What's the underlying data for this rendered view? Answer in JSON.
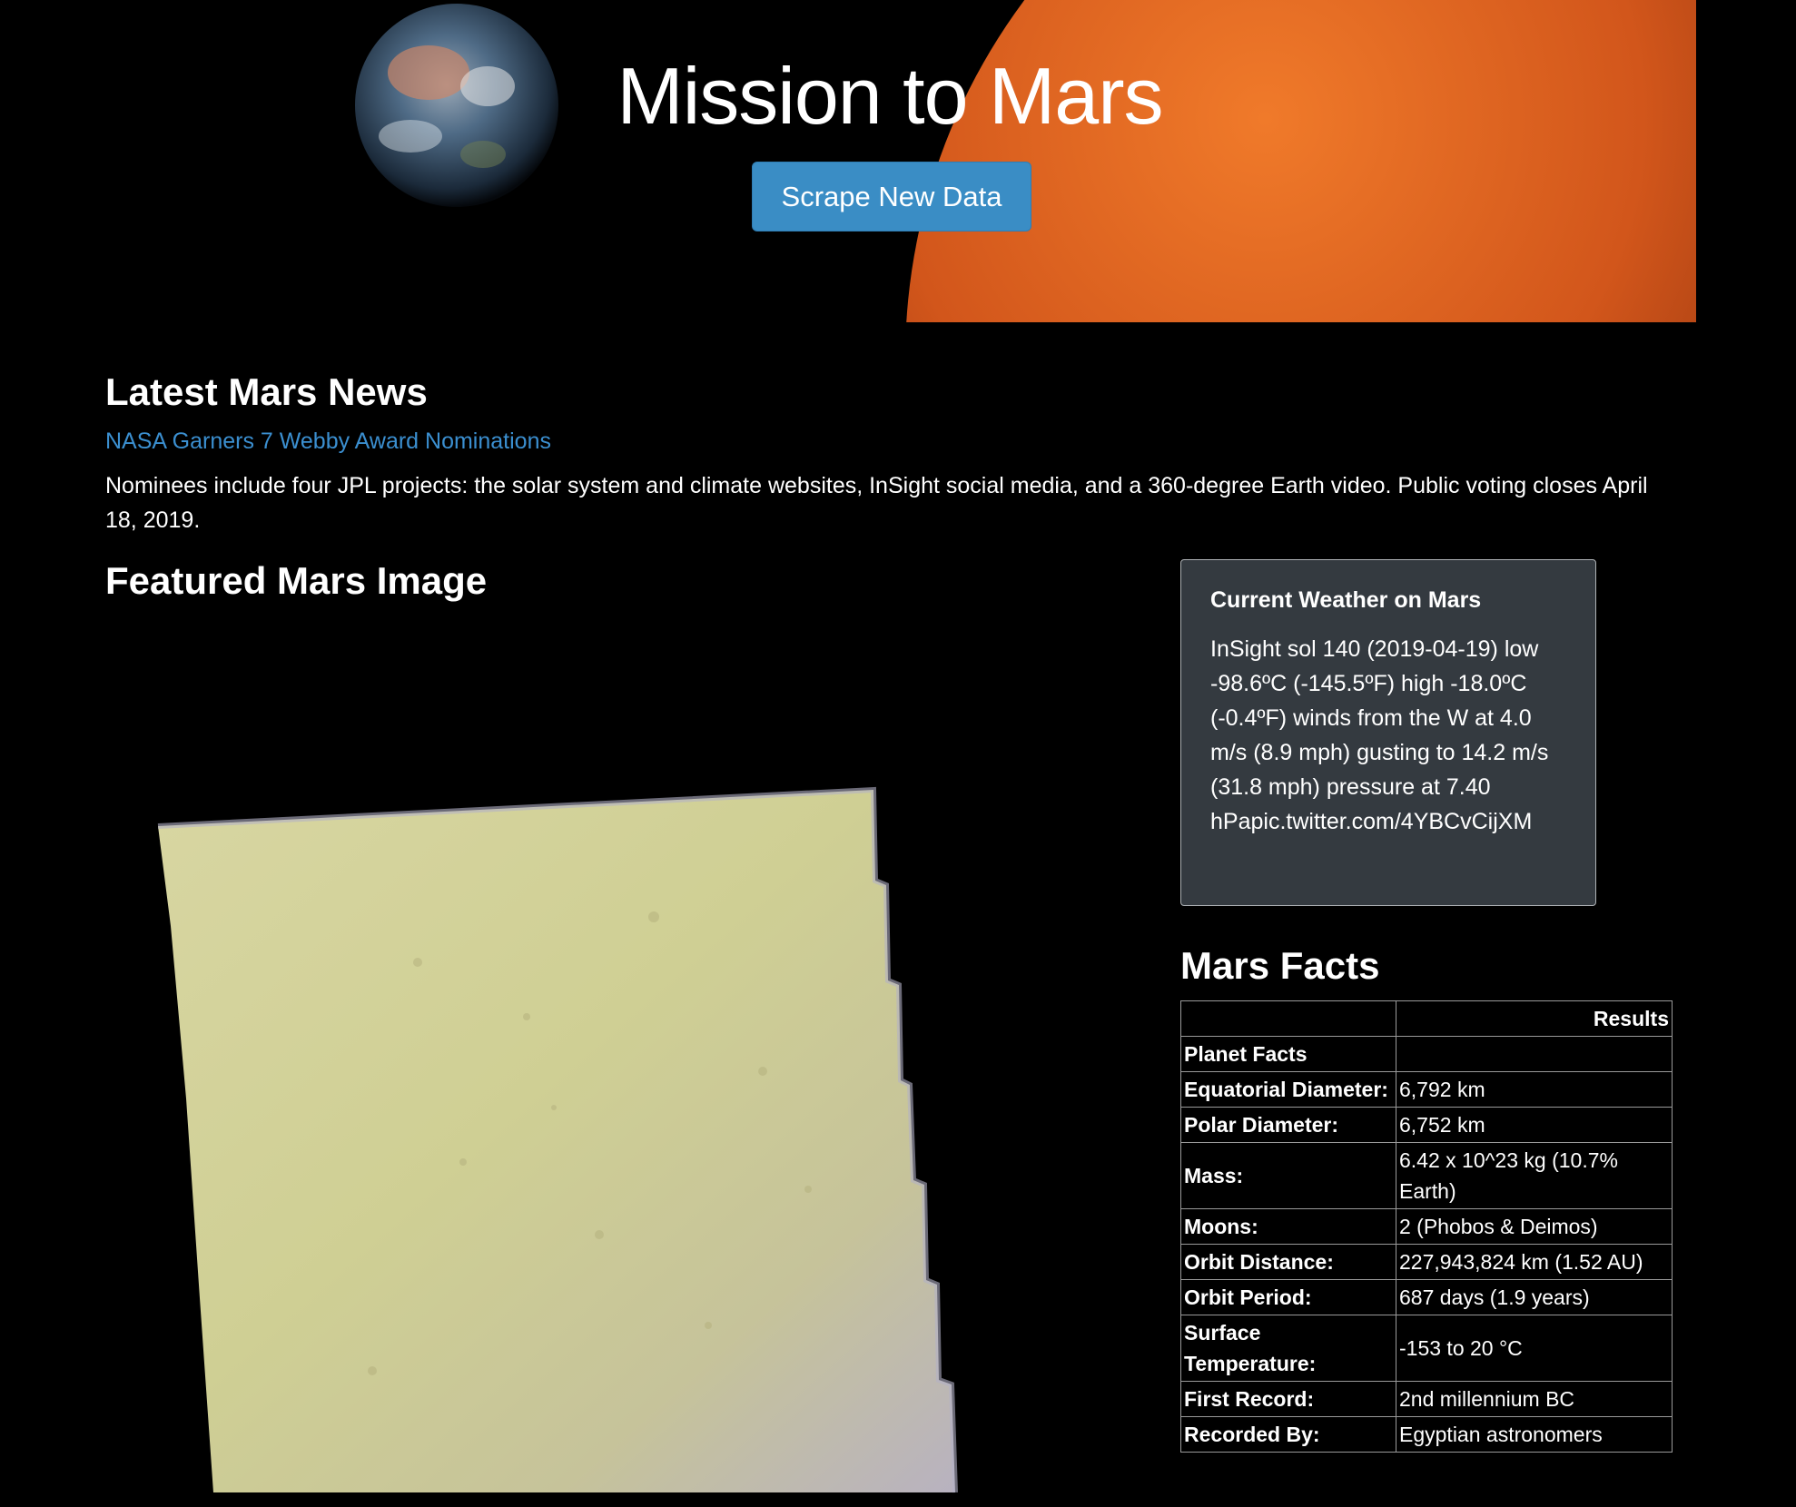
{
  "hero": {
    "title": "Mission to Mars",
    "button_label": "Scrape New Data"
  },
  "news": {
    "heading": "Latest Mars News",
    "headline": "NASA Garners 7 Webby Award Nominations",
    "paragraph": "Nominees include four JPL projects: the solar system and climate websites, InSight social media, and a 360-degree Earth video. Public voting closes April 18, 2019."
  },
  "featured": {
    "heading": "Featured Mars Image"
  },
  "weather": {
    "title": "Current Weather on Mars",
    "text": "InSight sol 140 (2019-04-19) low -98.6ºC (-145.5ºF) high -18.0ºC (-0.4ºF) winds from the W at 4.0 m/s (8.9 mph) gusting to 14.2 m/s (31.8 mph) pressure at 7.40 hPapic.twitter.com/4YBCvCijXM"
  },
  "facts": {
    "heading": "Mars Facts",
    "header": [
      "",
      "Results"
    ],
    "rows": [
      [
        "Planet Facts",
        ""
      ],
      [
        "Equatorial Diameter:",
        "6,792 km"
      ],
      [
        "Polar Diameter:",
        "6,752 km"
      ],
      [
        "Mass:",
        "6.42 x 10^23 kg (10.7% Earth)"
      ],
      [
        "Moons:",
        "2 (Phobos & Deimos)"
      ],
      [
        "Orbit Distance:",
        "227,943,824 km (1.52 AU)"
      ],
      [
        "Orbit Period:",
        "687 days (1.9 years)"
      ],
      [
        "Surface Temperature:",
        "-153 to 20 °C"
      ],
      [
        "First Record:",
        "2nd millennium BC"
      ],
      [
        "Recorded By:",
        "Egyptian astronomers"
      ]
    ]
  },
  "colors": {
    "accent_button": "#3a8dc5",
    "link": "#3b8fd0",
    "card_bg": "#343a40"
  }
}
